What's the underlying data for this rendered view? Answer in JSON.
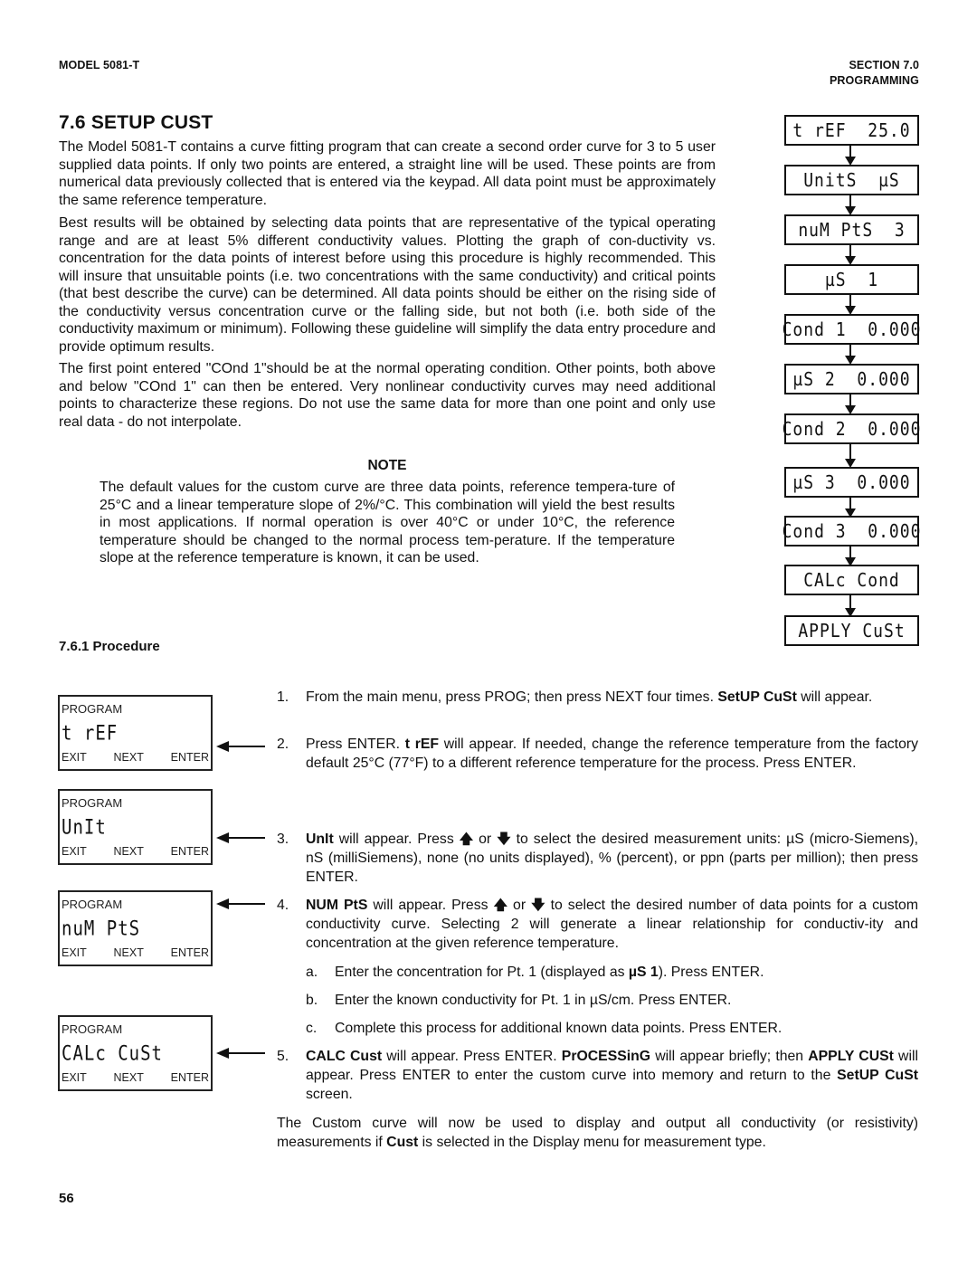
{
  "header": {
    "model": "MODEL 5081-T",
    "section": "SECTION 7.0",
    "section_title": "PROGRAMMING"
  },
  "title": "7.6 SETUP CUST",
  "paragraphs": [
    "The Model 5081-T contains a curve fitting program that can create a second order curve for 3 to 5 user supplied data points. If only two points are entered, a straight line will be used. These points are from numerical data previously collected that is entered via the keypad. All data point must be approximately the same reference temperature.",
    "Best results will be obtained by selecting data points that are representative of the typical operating range and are at least 5% different conductivity values. Plotting the graph of con-ductivity vs. concentration for the data points of interest before using this procedure is highly recommended. This will insure that unsuitable points (i.e. two concentrations with the same conductivity) and critical points (that best describe the curve) can be determined. All data points should be either on the rising side of the conductivity versus concentration curve or the falling side, but not both (i.e. both side of the conductivity maximum or minimum). Following these guideline will simplify the data entry procedure and provide optimum results.",
    "The first point entered \"COnd 1\"should be at the normal operating condition. Other points, both above and below \"COnd 1\" can then be entered. Very nonlinear conductivity curves may need additional points to characterize these regions. Do not use the same data for more than one point and only use real data - do not interpolate."
  ],
  "note": {
    "heading": "NOTE",
    "text": "The default values for the custom curve are three data points, reference tempera-ture of 25°C and a linear temperature slope of 2%/°C. This combination will yield the best results in most applications. If normal operation is over 40°C or under 10°C, the reference temperature should be changed to the normal process tem-perature. If the temperature slope at the reference temperature is known, it can be used."
  },
  "flow": [
    {
      "display": "t rEF  25.0"
    },
    {
      "display": "UnitS  µS"
    },
    {
      "display": "nuM PtS  3"
    },
    {
      "display": "µS  1"
    },
    {
      "display": "Cond 1  0.000"
    },
    {
      "display": "µS 2  0.000"
    },
    {
      "display": "Cond 2  0.000"
    },
    {
      "display": "µS 3  0.000"
    },
    {
      "display": "Cond 3  0.000"
    },
    {
      "display": "CALc Cond"
    },
    {
      "display": "APPLY CuSt"
    }
  ],
  "procedure_heading": "7.6.1 Procedure",
  "screens": [
    {
      "title": "PROGRAM",
      "display": "t rEF",
      "keys": [
        "EXIT",
        "NEXT",
        "ENTER"
      ]
    },
    {
      "title": "PROGRAM",
      "display": "UnIt",
      "keys": [
        "EXIT",
        "NEXT",
        "ENTER"
      ]
    },
    {
      "title": "PROGRAM",
      "display": "nuM PtS",
      "keys": [
        "EXIT",
        "NEXT",
        "ENTER"
      ]
    },
    {
      "title": "PROGRAM",
      "display": "CALc CuSt",
      "keys": [
        "EXIT",
        "NEXT",
        "ENTER"
      ]
    }
  ],
  "steps": [
    {
      "num": "1.",
      "bold1": "",
      "pre": "From the main menu, press PROG; then press NEXT four times. ",
      "bold": "SetUP CuSt",
      "post": " will appear."
    },
    {
      "num": "2.",
      "pre": "Press ENTER.  ",
      "bold": "t rEF",
      "post": " will appear.  If needed, change the reference temperature from the factory default 25°C (77°F) to a different reference temperature for the process. Press ENTER."
    },
    {
      "num": "3.",
      "bold": "UnIt",
      "mid1": " will appear. Press ",
      "up": "🡅",
      "or": " or ",
      "down": "🡇",
      "post": " to select the desired measurement units: µS (micro-Siemens), nS (milliSiemens), none (no units displayed), % (percent), or ppn (parts per million); then press ENTER."
    },
    {
      "num": "4.",
      "bold": "NUM PtS",
      "mid1": " will appear.  Press ",
      "up": "🡅",
      "or": " or ",
      "down": "🡇",
      "post": " to select the desired number of data points for a custom conductivity curve. Selecting 2 will generate a linear relationship for conductiv-ity and concentration at the given reference temperature."
    },
    {
      "num": "5.",
      "bold": "CALC Cust",
      "mid1": " will appear. Press ENTER. ",
      "bold2": "PrOCESSinG",
      "mid2": " will appear briefly; then ",
      "bold3": "APPLY CUSt",
      "mid3": " will appear. Press ENTER to enter the custom curve into memory and return to the ",
      "bold4": "SetUP CuSt",
      "post": " screen."
    }
  ],
  "substeps": [
    {
      "num": "a.",
      "pre": "Enter the concentration for Pt. 1 (displayed as  ",
      "bold": "µS 1",
      "post": ").  Press ENTER."
    },
    {
      "num": "b.",
      "pre": "Enter the known conductivity for Pt. 1 in  µS/cm. Press ENTER."
    },
    {
      "num": "c.",
      "pre": "Complete this process for additional known data points. Press ENTER."
    }
  ],
  "closing": {
    "pre": "The Custom curve will now be used to display and output all conductivity (or resistivity) measurements if ",
    "bold": "Cust",
    "post": " is selected in the Display menu for measurement type."
  },
  "page_number": "56"
}
